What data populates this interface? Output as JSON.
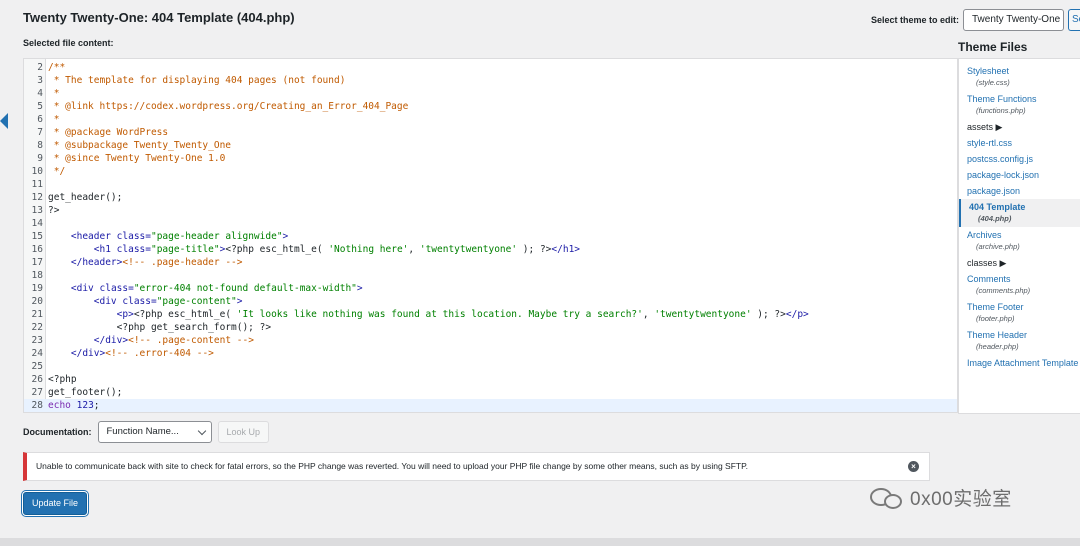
{
  "page": {
    "title": "Twenty Twenty-One: 404 Template (404.php)",
    "selected_file_label": "Selected file content:"
  },
  "theme_select": {
    "label": "Select theme to edit:",
    "value": "Twenty Twenty-One",
    "button": "Se"
  },
  "code_lines": [
    {
      "n": "2",
      "parts": [
        [
          "comment",
          "/**"
        ]
      ]
    },
    {
      "n": "3",
      "parts": [
        [
          "comment",
          " * The template for displaying 404 pages (not found)"
        ]
      ]
    },
    {
      "n": "4",
      "parts": [
        [
          "comment",
          " *"
        ]
      ]
    },
    {
      "n": "5",
      "parts": [
        [
          "comment",
          " * @link https://codex.wordpress.org/Creating_an_Error_404_Page"
        ]
      ]
    },
    {
      "n": "6",
      "parts": [
        [
          "comment",
          " *"
        ]
      ]
    },
    {
      "n": "7",
      "parts": [
        [
          "comment",
          " * @package WordPress"
        ]
      ]
    },
    {
      "n": "8",
      "parts": [
        [
          "comment",
          " * @subpackage Twenty_Twenty_One"
        ]
      ]
    },
    {
      "n": "9",
      "parts": [
        [
          "comment",
          " * @since Twenty Twenty-One 1.0"
        ]
      ]
    },
    {
      "n": "10",
      "parts": [
        [
          "comment",
          " */"
        ]
      ]
    },
    {
      "n": "11",
      "parts": []
    },
    {
      "n": "12",
      "parts": [
        [
          "plain",
          "get_header();"
        ]
      ]
    },
    {
      "n": "13",
      "parts": [
        [
          "plain",
          "?>"
        ]
      ]
    },
    {
      "n": "14",
      "parts": []
    },
    {
      "n": "15",
      "parts": [
        [
          "plain",
          "    "
        ],
        [
          "tag",
          "<header "
        ],
        [
          "attr",
          "class="
        ],
        [
          "string",
          "\"page-header alignwide\""
        ],
        [
          "tag",
          ">"
        ]
      ]
    },
    {
      "n": "16",
      "parts": [
        [
          "plain",
          "        "
        ],
        [
          "tag",
          "<h1 "
        ],
        [
          "attr",
          "class="
        ],
        [
          "string",
          "\"page-title\""
        ],
        [
          "tag",
          ">"
        ],
        [
          "plain",
          "<?php esc_html_e( "
        ],
        [
          "string",
          "'Nothing here'"
        ],
        [
          "plain",
          ", "
        ],
        [
          "string",
          "'twentytwentyone'"
        ],
        [
          "plain",
          " ); ?>"
        ],
        [
          "tag",
          "</h1>"
        ]
      ]
    },
    {
      "n": "17",
      "parts": [
        [
          "plain",
          "    "
        ],
        [
          "tag",
          "</header>"
        ],
        [
          "comment",
          "<!-- .page-header -->"
        ]
      ]
    },
    {
      "n": "18",
      "parts": []
    },
    {
      "n": "19",
      "parts": [
        [
          "plain",
          "    "
        ],
        [
          "tag",
          "<div "
        ],
        [
          "attr",
          "class="
        ],
        [
          "string",
          "\"error-404 not-found default-max-width\""
        ],
        [
          "tag",
          ">"
        ]
      ]
    },
    {
      "n": "20",
      "parts": [
        [
          "plain",
          "        "
        ],
        [
          "tag",
          "<div "
        ],
        [
          "attr",
          "class="
        ],
        [
          "string",
          "\"page-content\""
        ],
        [
          "tag",
          ">"
        ]
      ]
    },
    {
      "n": "21",
      "parts": [
        [
          "plain",
          "            "
        ],
        [
          "tag",
          "<p>"
        ],
        [
          "plain",
          "<?php esc_html_e( "
        ],
        [
          "string",
          "'It looks like nothing was found at this location. Maybe try a search?'"
        ],
        [
          "plain",
          ", "
        ],
        [
          "string",
          "'twentytwentyone'"
        ],
        [
          "plain",
          " ); ?>"
        ],
        [
          "tag",
          "</p>"
        ]
      ]
    },
    {
      "n": "22",
      "parts": [
        [
          "plain",
          "            <?php get_search_form(); ?>"
        ]
      ]
    },
    {
      "n": "23",
      "parts": [
        [
          "plain",
          "        "
        ],
        [
          "tag",
          "</div>"
        ],
        [
          "comment",
          "<!-- .page-content -->"
        ]
      ]
    },
    {
      "n": "24",
      "parts": [
        [
          "plain",
          "    "
        ],
        [
          "tag",
          "</div>"
        ],
        [
          "comment",
          "<!-- .error-404 -->"
        ]
      ]
    },
    {
      "n": "25",
      "parts": []
    },
    {
      "n": "26",
      "parts": [
        [
          "plain",
          "<?php"
        ]
      ]
    },
    {
      "n": "27",
      "parts": [
        [
          "plain",
          "get_footer();"
        ]
      ]
    },
    {
      "n": "28",
      "parts": [
        [
          "keyword",
          "echo"
        ],
        [
          "plain",
          " "
        ],
        [
          "number",
          "123"
        ],
        [
          "plain",
          ";"
        ]
      ],
      "active": true
    }
  ],
  "theme_files": {
    "title": "Theme Files",
    "items": [
      {
        "name": "Stylesheet",
        "sub": "(style.css)"
      },
      {
        "name": "Theme Functions",
        "sub": "(functions.php)"
      },
      {
        "name": "assets ▶",
        "folder": true
      },
      {
        "name": "style-rtl.css"
      },
      {
        "name": "postcss.config.js"
      },
      {
        "name": "package-lock.json"
      },
      {
        "name": "package.json"
      },
      {
        "name": "404 Template",
        "sub": "(404.php)",
        "current": true
      },
      {
        "name": "Archives",
        "sub": "(archive.php)"
      },
      {
        "name": "classes ▶",
        "folder": true
      },
      {
        "name": "Comments",
        "sub": "(comments.php)"
      },
      {
        "name": "Theme Footer",
        "sub": "(footer.php)"
      },
      {
        "name": "Theme Header",
        "sub": "(header.php)"
      },
      {
        "name": "Image Attachment Template"
      }
    ]
  },
  "documentation": {
    "label": "Documentation:",
    "select_value": "Function Name...",
    "lookup_label": "Look Up"
  },
  "notice": {
    "text": "Unable to communicate back with site to check for fatal errors, so the PHP change was reverted. You will need to upload your PHP file change by some other means, such as by using SFTP.",
    "close_glyph": "×"
  },
  "update_button": "Update File",
  "watermark": "0x00实验室"
}
